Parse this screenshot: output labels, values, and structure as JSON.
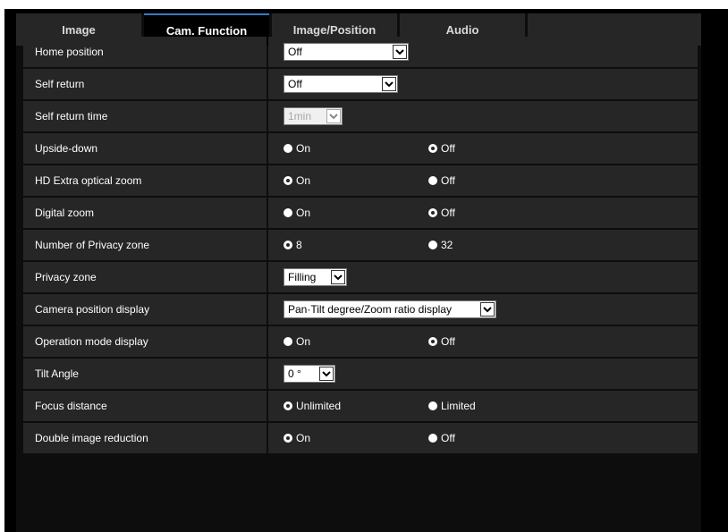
{
  "tabs": [
    {
      "label": "Image",
      "active": false
    },
    {
      "label": "Cam. Function",
      "active": true
    },
    {
      "label": "Image/Position",
      "active": false
    },
    {
      "label": "Audio",
      "active": false
    }
  ],
  "settings": {
    "home_position": {
      "label": "Home position",
      "value": "Off"
    },
    "self_return": {
      "label": "Self return",
      "value": "Off"
    },
    "self_return_time": {
      "label": "Self return time",
      "value": "1min",
      "disabled": true
    },
    "upside_down": {
      "label": "Upside-down",
      "option1": "On",
      "option2": "Off",
      "selected": "Off"
    },
    "hd_extra_zoom": {
      "label": "HD Extra optical zoom",
      "option1": "On",
      "option2": "Off",
      "selected": "On"
    },
    "digital_zoom": {
      "label": "Digital zoom",
      "option1": "On",
      "option2": "Off",
      "selected": "Off"
    },
    "privacy_zone_count": {
      "label": "Number of Privacy zone",
      "option1": "8",
      "option2": "32",
      "selected": "8"
    },
    "privacy_zone": {
      "label": "Privacy zone",
      "value": "Filling"
    },
    "camera_position_display": {
      "label": "Camera position display",
      "value": "Pan·Tilt degree/Zoom ratio display"
    },
    "operation_mode_display": {
      "label": "Operation mode display",
      "option1": "On",
      "option2": "Off",
      "selected": "Off"
    },
    "tilt_angle": {
      "label": "Tilt Angle",
      "value": "0 °"
    },
    "focus_distance": {
      "label": "Focus distance",
      "option1": "Unlimited",
      "option2": "Limited",
      "selected": "Unlimited"
    },
    "double_image_reduction": {
      "label": "Double image reduction",
      "option1": "On",
      "option2": "Off",
      "selected": "On"
    }
  },
  "colors": {
    "background": "#000000",
    "row": "#262626",
    "active_tab_accent": "#3a78c4",
    "text": "#ffffff"
  }
}
